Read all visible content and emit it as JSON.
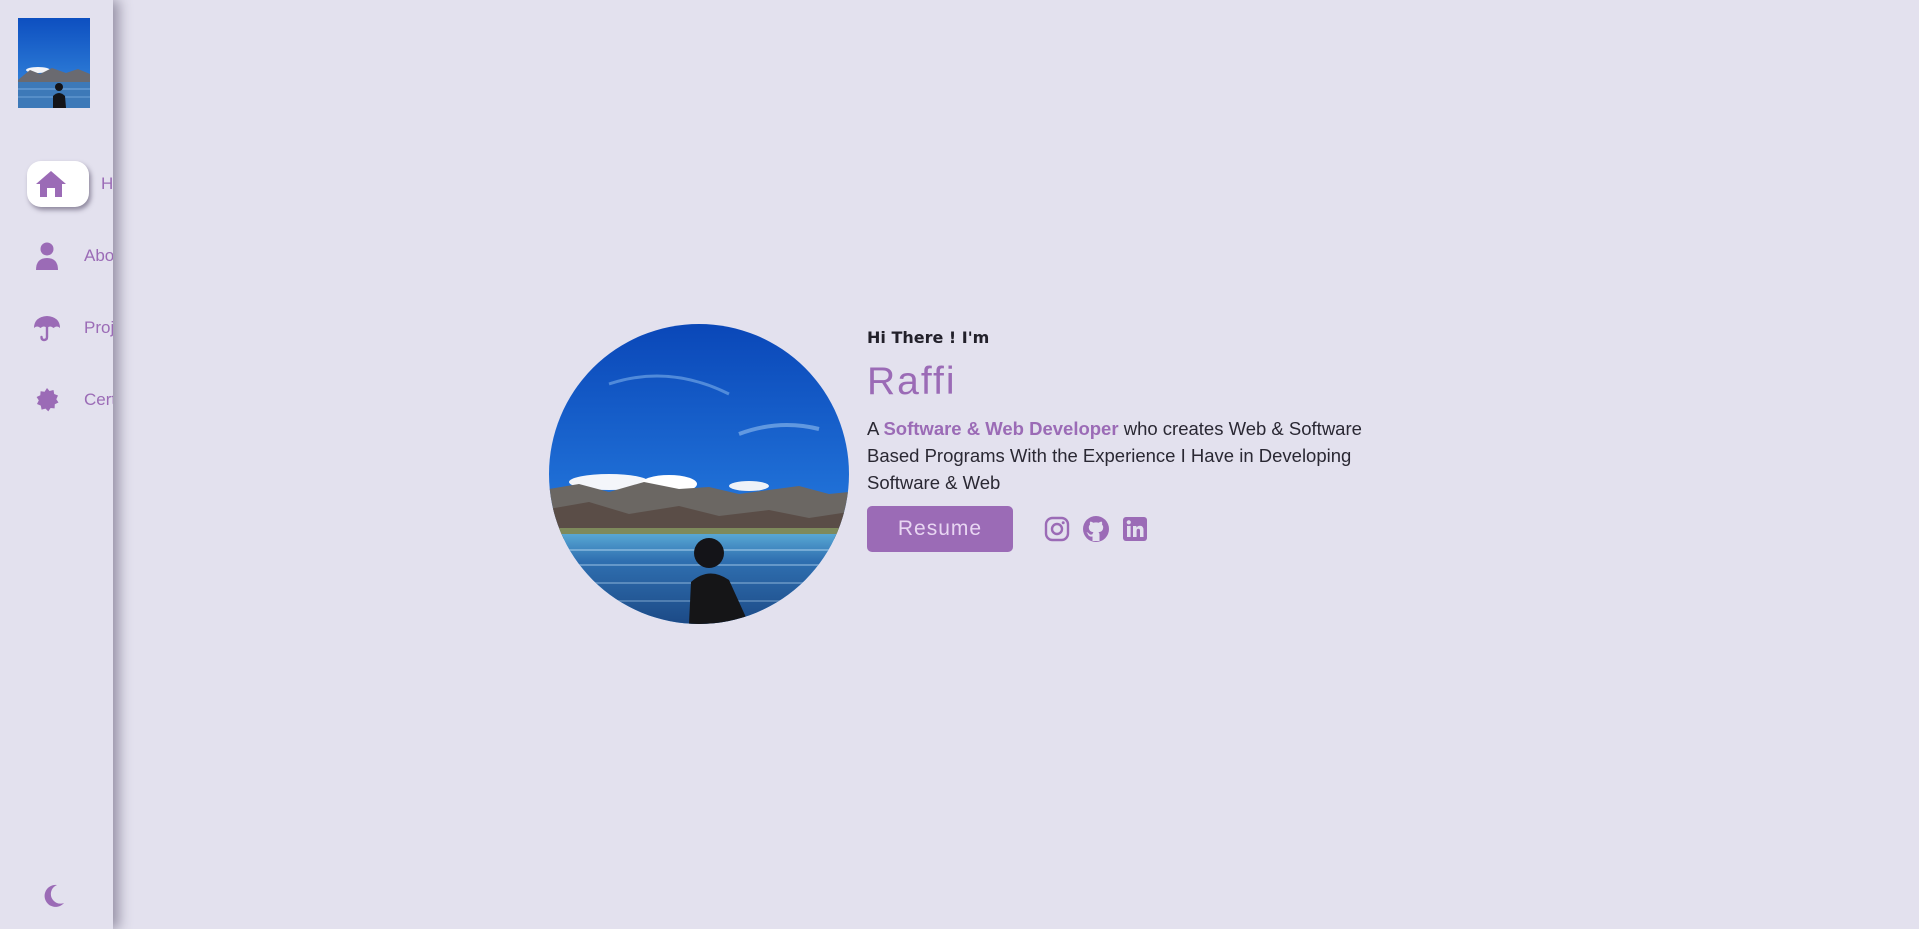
{
  "theme": {
    "accent": "#9b6bb6",
    "background": "#e3e1ee",
    "text": "#2a2833"
  },
  "sidebar": {
    "avatar_icon": "profile-photo",
    "items": [
      {
        "label": "Home",
        "icon": "home-icon",
        "active": true
      },
      {
        "label": "About",
        "icon": "user-icon",
        "active": false
      },
      {
        "label": "Projects",
        "icon": "umbrella-icon",
        "active": false
      },
      {
        "label": "Certificates",
        "icon": "badge-icon",
        "active": false
      }
    ],
    "theme_toggle_icon": "moon-icon"
  },
  "hero": {
    "greeting": "Hi There ! I'm",
    "name": "Raffi",
    "bio_prefix": "A ",
    "bio_role": "Software & Web Developer",
    "bio_suffix": " who creates Web & Software Based Programs With the Experience I Have in Developing Software & Web",
    "resume_label": "Resume",
    "socials": [
      {
        "name": "Instagram",
        "icon": "instagram-icon"
      },
      {
        "name": "GitHub",
        "icon": "github-icon"
      },
      {
        "name": "LinkedIn",
        "icon": "linkedin-icon"
      }
    ]
  }
}
